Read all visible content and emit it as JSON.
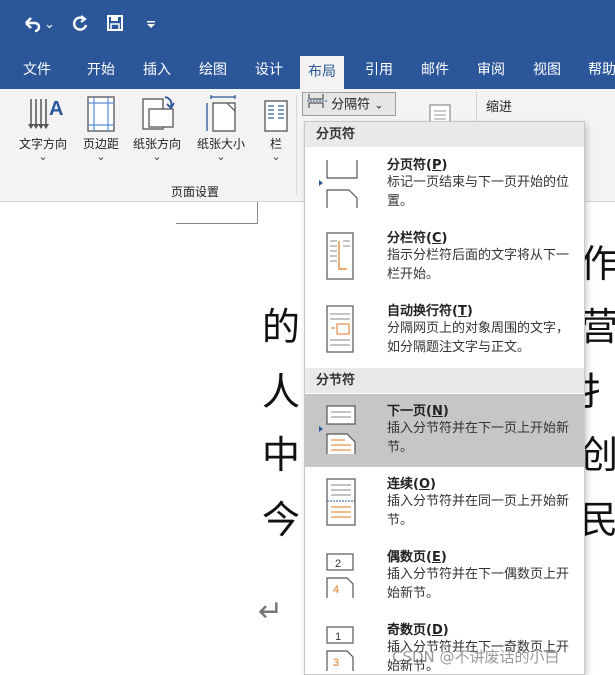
{
  "quick_access": {
    "undo_icon": "undo-icon",
    "undo_dropdown": "⌄",
    "redo_icon": "redo-icon",
    "save_icon": "save-icon",
    "customize_icon": "customize-icon"
  },
  "tabs": [
    {
      "label": "文件"
    },
    {
      "label": "开始"
    },
    {
      "label": "插入"
    },
    {
      "label": "绘图"
    },
    {
      "label": "设计"
    },
    {
      "label": "布局"
    },
    {
      "label": "引用"
    },
    {
      "label": "邮件"
    },
    {
      "label": "审阅"
    },
    {
      "label": "视图"
    },
    {
      "label": "帮助"
    }
  ],
  "ribbon": {
    "buttons": [
      {
        "label": "文字方向",
        "chevron": "⌄"
      },
      {
        "label": "页边距",
        "chevron": "⌄"
      },
      {
        "label": "纸张方向",
        "chevron": "⌄"
      },
      {
        "label": "纸张大小",
        "chevron": "⌄"
      },
      {
        "label": "栏",
        "chevron": "⌄"
      }
    ],
    "group_label": "页面设置",
    "breaks_label": "分隔符",
    "breaks_chevron": "⌄",
    "indent_label": "缩进"
  },
  "menu": {
    "section1": "分页符",
    "section2": "分节符",
    "items": [
      {
        "title": "分页符",
        "key": "P",
        "desc": "标记一页结束与下一页开始的位置。"
      },
      {
        "title": "分栏符",
        "key": "C",
        "desc": "指示分栏符后面的文字将从下一栏开始。"
      },
      {
        "title": "自动换行符",
        "key": "T",
        "desc": "分隔网页上的对象周围的文字，如分隔题注文字与正文。"
      },
      {
        "title": "下一页",
        "key": "N",
        "desc": "插入分节符并在下一页上开始新节。"
      },
      {
        "title": "连续",
        "key": "O",
        "desc": "插入分节符并在同一页上开始新节。"
      },
      {
        "title": "偶数页",
        "key": "E",
        "desc": "插入分节符并在下一偶数页上开始新节。"
      },
      {
        "title": "奇数页",
        "key": "D",
        "desc": "插入分节符并在下一奇数页上开始新节。"
      }
    ]
  },
  "document": {
    "left_chars": [
      "的",
      "人",
      "中",
      "今"
    ],
    "right_chars": [
      "作",
      "营",
      "扌",
      "创",
      "民"
    ],
    "return_mark": "↵"
  },
  "watermark": "CSDN @不讲废话的小白"
}
